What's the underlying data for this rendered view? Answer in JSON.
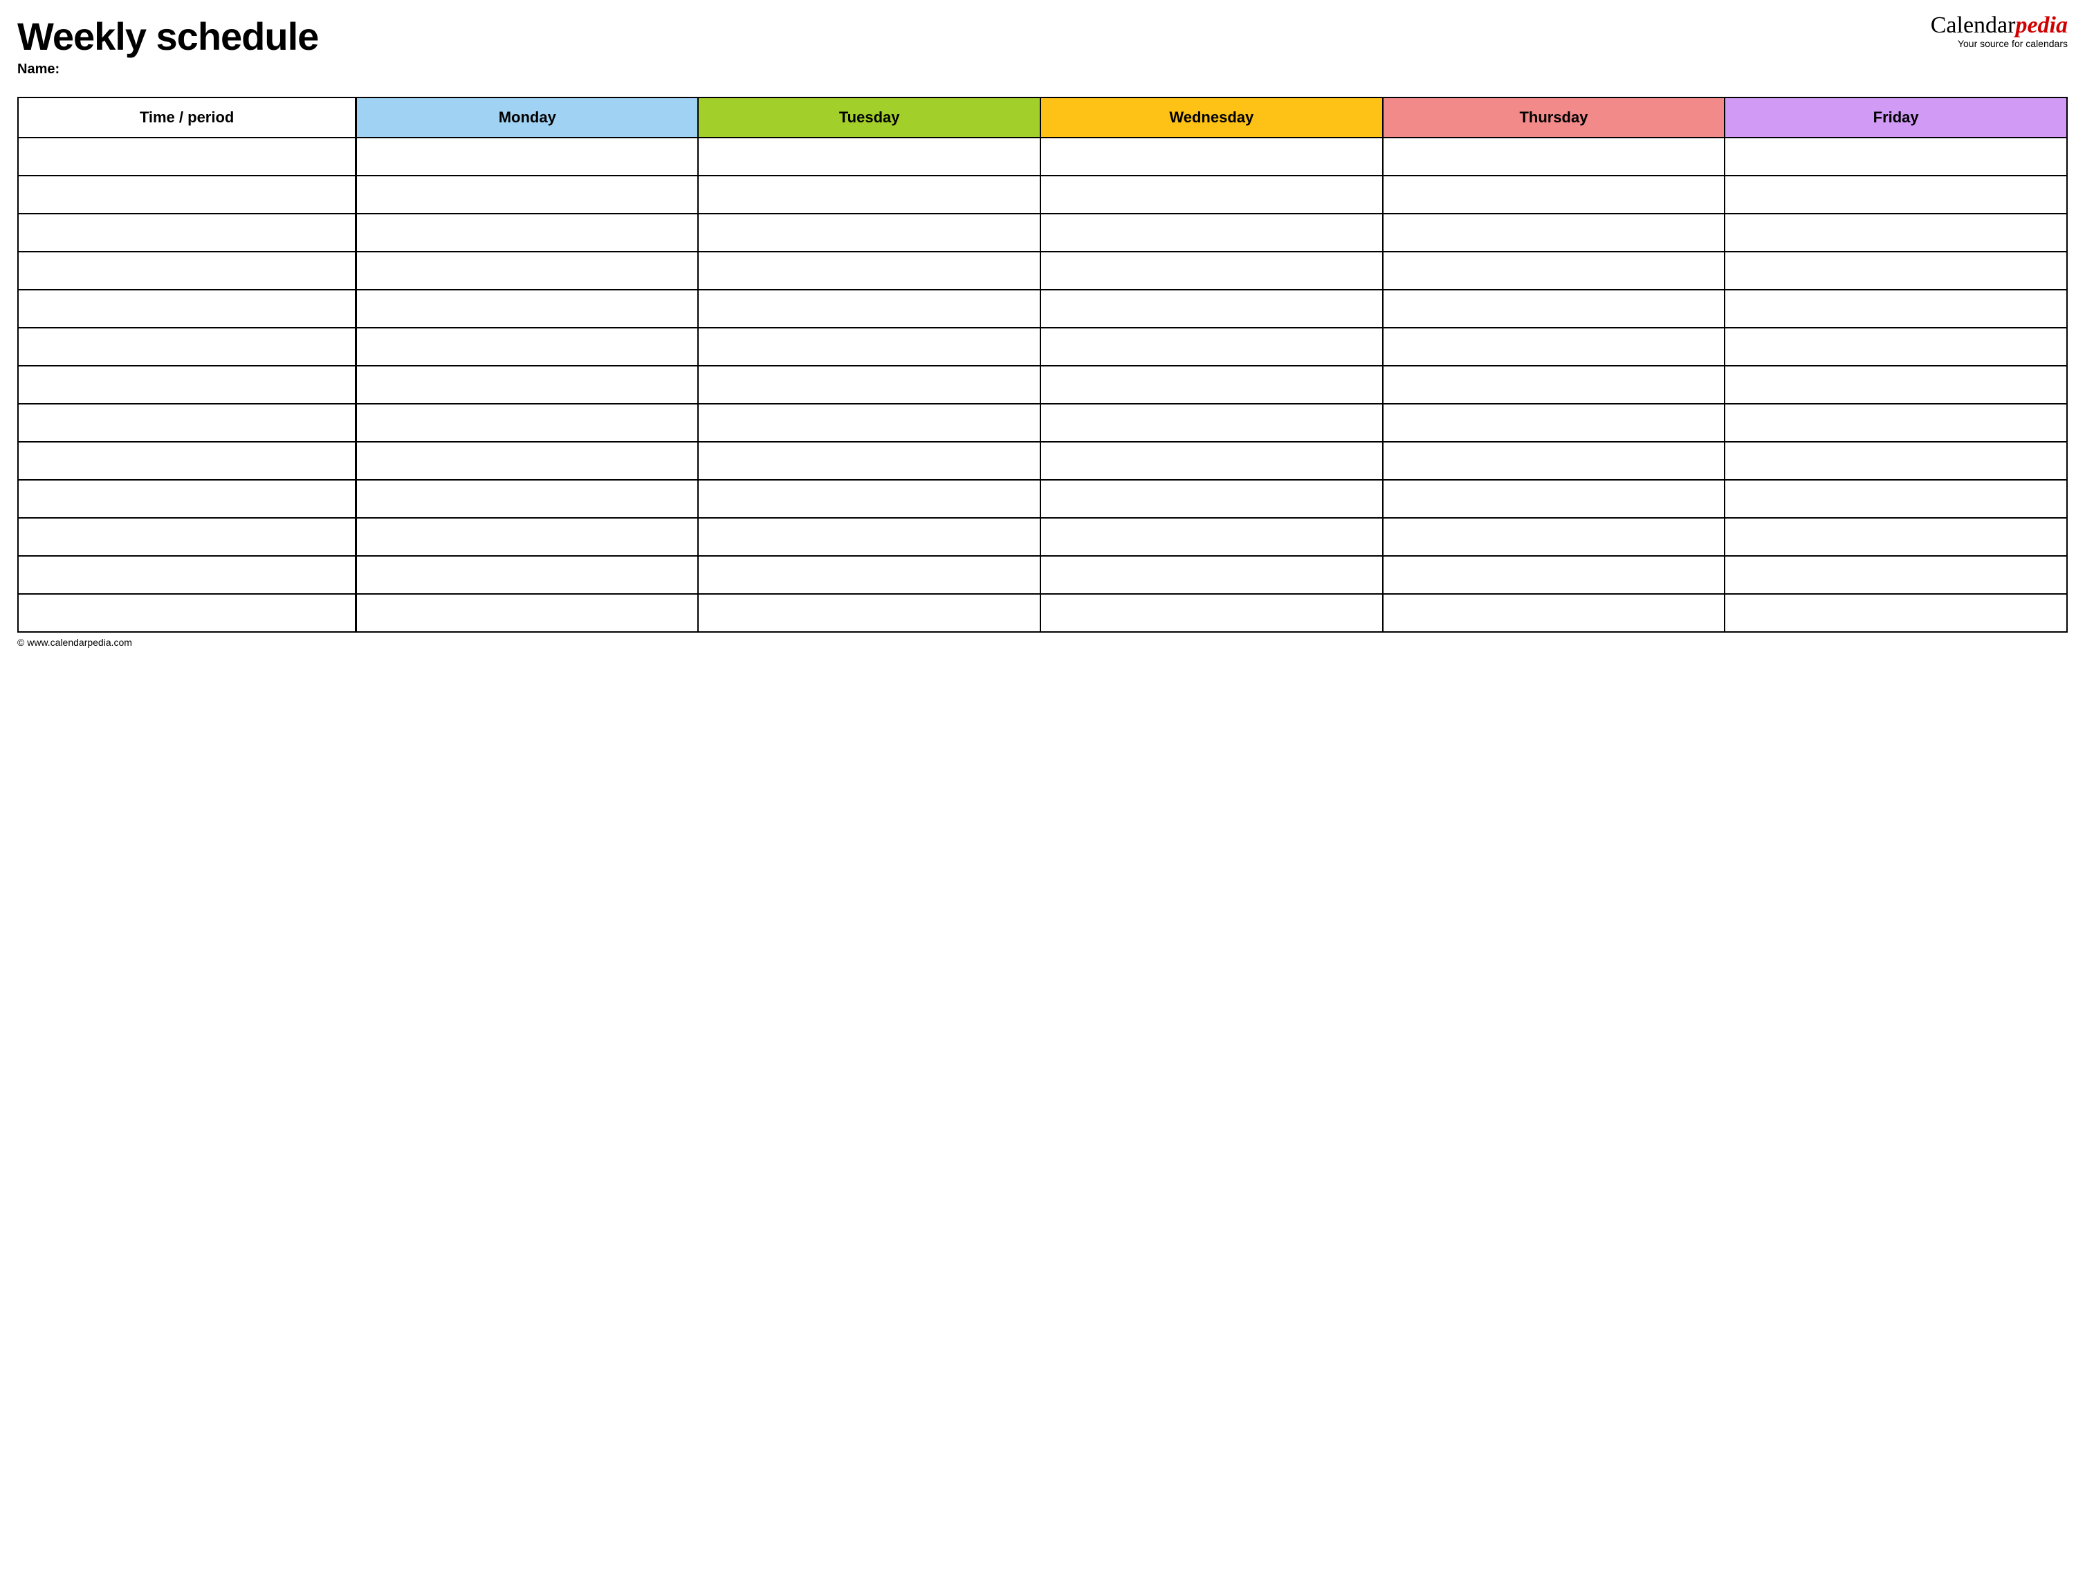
{
  "header": {
    "title": "Weekly schedule",
    "name_label": "Name:",
    "brand_prefix": "Calendar",
    "brand_suffix": "pedia",
    "brand_tagline": "Your source for calendars"
  },
  "table": {
    "time_header": "Time / period",
    "days": [
      {
        "label": "Monday",
        "color": "#a0d3f3"
      },
      {
        "label": "Tuesday",
        "color": "#a3cf2a"
      },
      {
        "label": "Wednesday",
        "color": "#fdc215"
      },
      {
        "label": "Thursday",
        "color": "#f38a8a"
      },
      {
        "label": "Friday",
        "color": "#d19af5"
      }
    ],
    "row_count": 13
  },
  "footer": {
    "copyright": "© www.calendarpedia.com"
  }
}
